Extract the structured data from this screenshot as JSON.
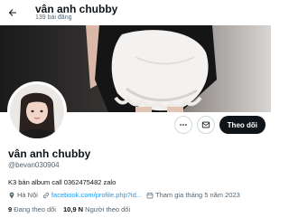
{
  "header": {
    "title": "vân anh chubby",
    "post_count": "139 bài đăng",
    "back_icon": "arrow-left-icon"
  },
  "profile": {
    "name": "vân anh chubby",
    "handle": "@bevan030904",
    "bio": "K3 bán album call 0362475482 zalo",
    "location": "Hà Nội",
    "website": "facebook.com/profile.php?id...",
    "joined": "Tham gia tháng 5 năm 2023"
  },
  "actions": {
    "more_icon": "more-icon",
    "message_icon": "message-icon",
    "follow_label": "Theo dõi"
  },
  "stats": {
    "following_count": "9",
    "following_label": "Đang theo dõi",
    "followers_count": "10,9 N",
    "followers_label": "Người theo dõi"
  },
  "colors": {
    "accent": "#1d9bf0",
    "button_bg": "#0f1419",
    "muted_text": "#536471"
  }
}
